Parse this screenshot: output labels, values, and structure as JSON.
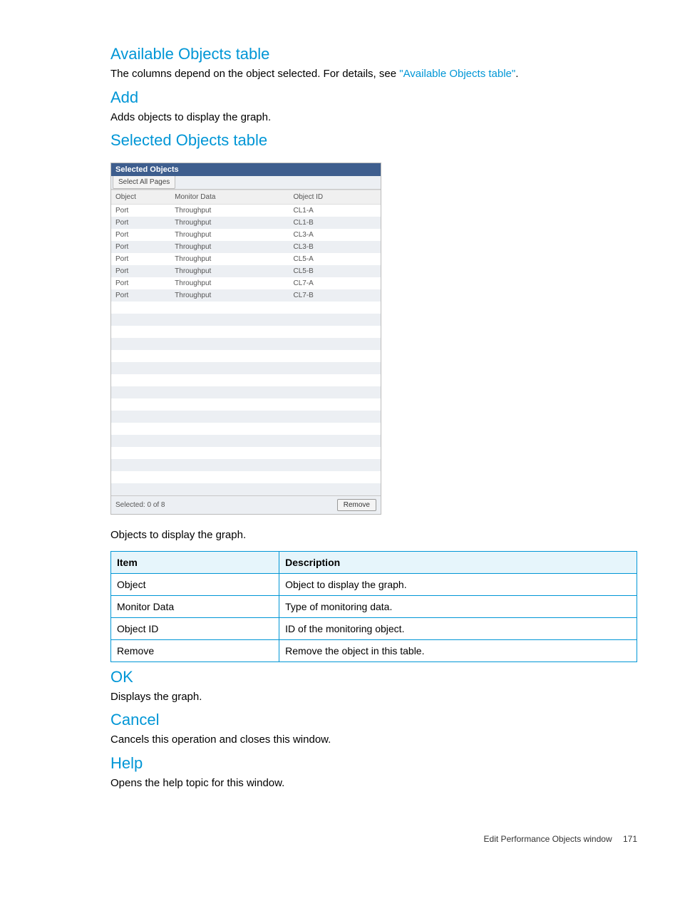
{
  "sections": {
    "available": {
      "heading": "Available Objects table",
      "text_before_link": "The columns depend on the object selected. For details, see ",
      "link": "\"Available Objects table\"",
      "text_after_link": "."
    },
    "add": {
      "heading": "Add",
      "text": "Adds objects to display the graph."
    },
    "selected": {
      "heading": "Selected Objects table",
      "desc": "Objects to display the graph."
    },
    "ok": {
      "heading": "OK",
      "text": "Displays the graph."
    },
    "cancel": {
      "heading": "Cancel",
      "text": "Cancels this operation and closes this window."
    },
    "help": {
      "heading": "Help",
      "text": "Opens the help topic for this window."
    }
  },
  "screenshot": {
    "title": "Selected Objects",
    "tab": "Select All Pages",
    "headers": {
      "object": "Object",
      "monitor_data": "Monitor Data",
      "object_id": "Object ID"
    },
    "rows": [
      {
        "object": "Port",
        "monitor_data": "Throughput",
        "object_id": "CL1-A"
      },
      {
        "object": "Port",
        "monitor_data": "Throughput",
        "object_id": "CL1-B"
      },
      {
        "object": "Port",
        "monitor_data": "Throughput",
        "object_id": "CL3-A"
      },
      {
        "object": "Port",
        "monitor_data": "Throughput",
        "object_id": "CL3-B"
      },
      {
        "object": "Port",
        "monitor_data": "Throughput",
        "object_id": "CL5-A"
      },
      {
        "object": "Port",
        "monitor_data": "Throughput",
        "object_id": "CL5-B"
      },
      {
        "object": "Port",
        "monitor_data": "Throughput",
        "object_id": "CL7-A"
      },
      {
        "object": "Port",
        "monitor_data": "Throughput",
        "object_id": "CL7-B"
      }
    ],
    "empty_rows": 16,
    "footer_status": "Selected:  0    of  8",
    "remove_btn": "Remove"
  },
  "desc_table": {
    "headers": {
      "item": "Item",
      "description": "Description"
    },
    "rows": [
      {
        "item": "Object",
        "description": "Object to display the graph."
      },
      {
        "item": "Monitor Data",
        "description": "Type of monitoring data."
      },
      {
        "item": "Object ID",
        "description": "ID of the monitoring object."
      },
      {
        "item": "Remove",
        "description": "Remove the object in this table."
      }
    ]
  },
  "footer": {
    "title": "Edit Performance Objects window",
    "page": "171"
  }
}
